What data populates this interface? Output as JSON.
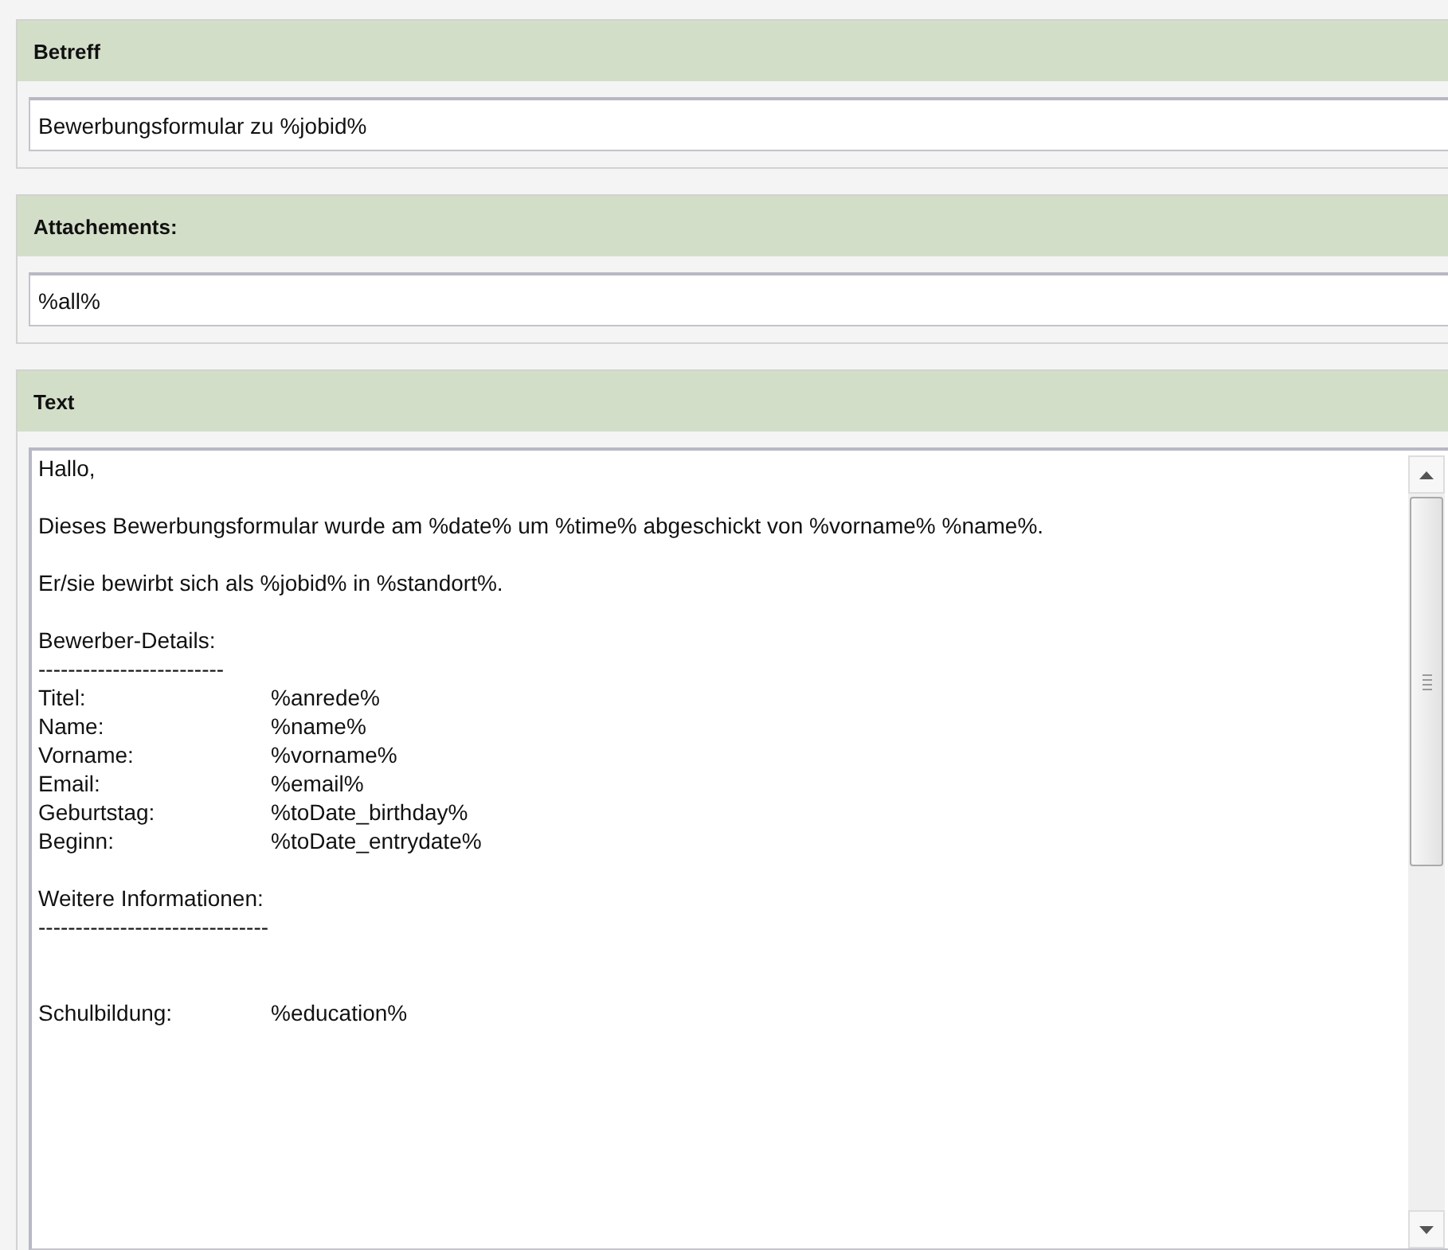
{
  "sections": [
    {
      "title": "Betreff",
      "kind": "input",
      "value": "Bewerbungsformular zu %jobid%"
    },
    {
      "title": "Attachements:",
      "kind": "input",
      "value": "%all%"
    },
    {
      "title": "Text",
      "kind": "textarea",
      "lines": [
        {
          "kind": "text",
          "text": "Hallo,"
        },
        {
          "kind": "blank"
        },
        {
          "kind": "text",
          "text": "Dieses Bewerbungsformular wurde am %date% um %time% abgeschickt von %vorname% %name%."
        },
        {
          "kind": "blank"
        },
        {
          "kind": "text",
          "text": "Er/sie bewirbt sich als %jobid% in %standort%."
        },
        {
          "kind": "blank"
        },
        {
          "kind": "text",
          "text": "Bewerber-Details:"
        },
        {
          "kind": "text",
          "text": "-------------------------"
        },
        {
          "kind": "field",
          "label": "Titel:",
          "value": "%anrede%"
        },
        {
          "kind": "field",
          "label": "Name:",
          "value": "%name%"
        },
        {
          "kind": "field",
          "label": "Vorname:",
          "value": "%vorname%"
        },
        {
          "kind": "field",
          "label": "Email:",
          "value": "%email%"
        },
        {
          "kind": "field",
          "label": "Geburtstag:",
          "value": "%toDate_birthday%"
        },
        {
          "kind": "field",
          "label": "Beginn:",
          "value": "%toDate_entrydate%"
        },
        {
          "kind": "blank"
        },
        {
          "kind": "text",
          "text": "Weitere Informationen:"
        },
        {
          "kind": "text",
          "text": "-------------------------------"
        },
        {
          "kind": "blank"
        },
        {
          "kind": "blank"
        },
        {
          "kind": "field",
          "label": "Schulbildung:",
          "value": "%education%"
        }
      ]
    }
  ]
}
